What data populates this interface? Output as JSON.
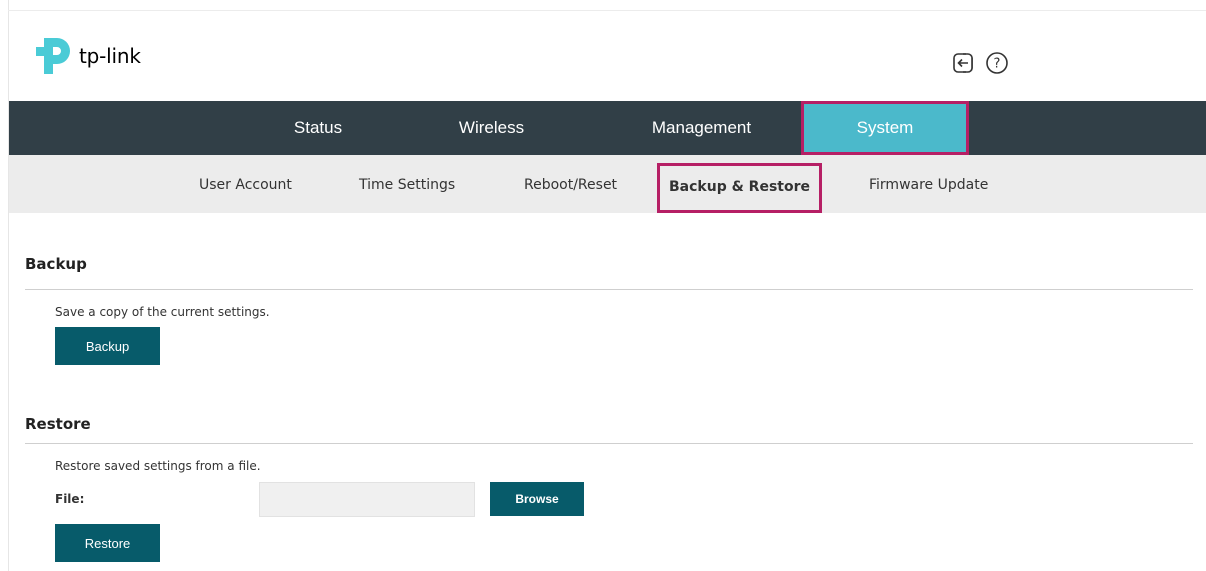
{
  "brand": {
    "name": "tp-link"
  },
  "header_icons": {
    "logout": "logout-icon",
    "help": "help-icon"
  },
  "top_nav": {
    "tabs": [
      {
        "label": "Status"
      },
      {
        "label": "Wireless"
      },
      {
        "label": "Management"
      },
      {
        "label": "System",
        "active": true
      }
    ]
  },
  "sub_nav": {
    "items": [
      {
        "label": "User Account"
      },
      {
        "label": "Time Settings"
      },
      {
        "label": "Reboot/Reset"
      },
      {
        "label": "Backup & Restore",
        "active": true
      },
      {
        "label": "Firmware Update"
      }
    ]
  },
  "backup": {
    "title": "Backup",
    "description": "Save a copy of the current settings.",
    "button": "Backup"
  },
  "restore": {
    "title": "Restore",
    "description": "Restore saved settings from a file.",
    "file_label": "File:",
    "file_value": "",
    "browse_button": "Browse",
    "button": "Restore"
  },
  "colors": {
    "nav_bg": "#313f47",
    "nav_active": "#4bb9cb",
    "highlight_border": "#b61f65",
    "button_bg": "#075b6a",
    "subnav_bg": "#ececec",
    "brand_teal": "#4acbd6"
  }
}
